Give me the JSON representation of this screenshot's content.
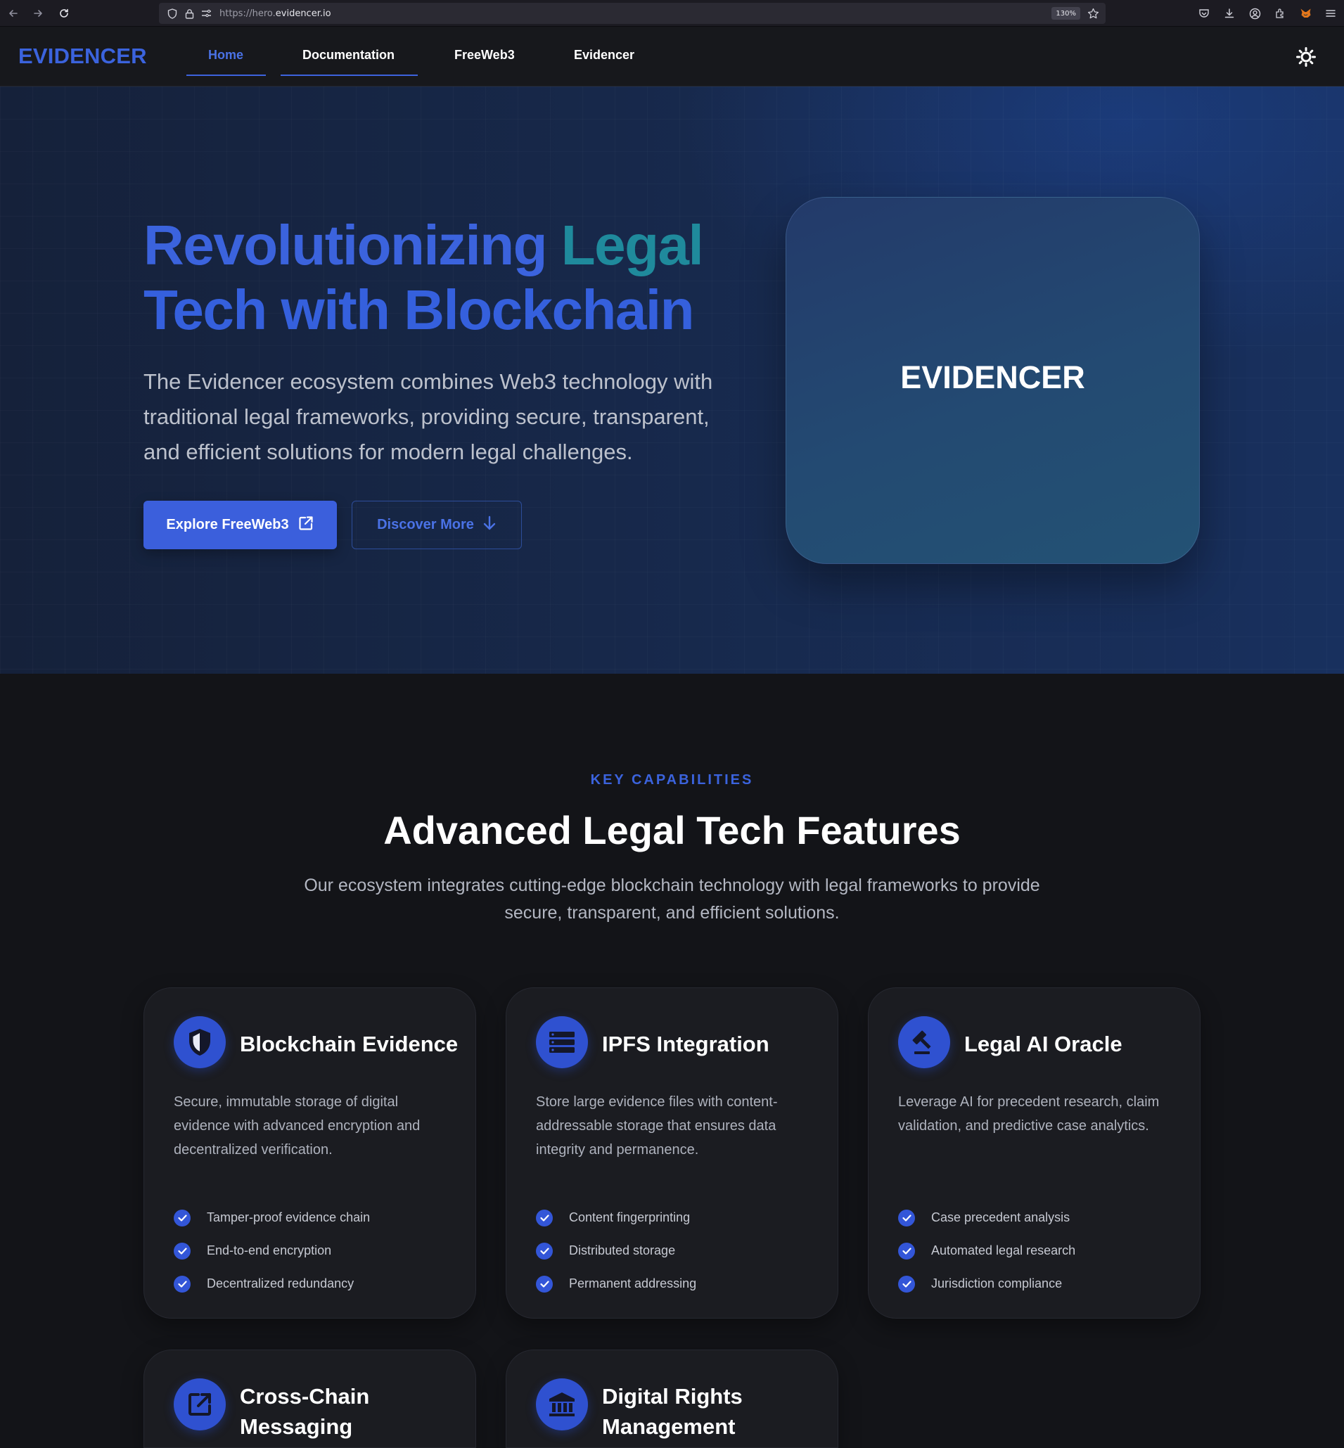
{
  "browser": {
    "url_prefix": "https://hero.",
    "url_host": "evidencer.io",
    "zoom": "130%"
  },
  "header": {
    "logo": "EVIDENCER",
    "nav": [
      {
        "label": "Home",
        "active": true
      },
      {
        "label": "Documentation",
        "active": false
      },
      {
        "label": "FreeWeb3",
        "active": false
      },
      {
        "label": "Evidencer",
        "active": false
      }
    ],
    "theme_icon": "sun-icon"
  },
  "hero": {
    "title_part1": "Revolutionizing ",
    "title_part2": "Legal",
    "title_part3": "Tech with Blockchain",
    "subtitle": "The Evidencer ecosystem combines Web3 technology with traditional legal frameworks, providing secure, transparent, and efficient solutions for modern legal challenges.",
    "primary_button": "Explore FreeWeb3",
    "secondary_button": "Discover More",
    "card_title": "EVIDENCER"
  },
  "features": {
    "eyebrow": "KEY CAPABILITIES",
    "title": "Advanced Legal Tech Features",
    "subtitle": "Our ecosystem integrates cutting-edge blockchain technology with legal frameworks to provide secure, transparent, and efficient solutions.",
    "cards": [
      {
        "icon": "shield-icon",
        "title": "Blockchain Evidence",
        "description": "Secure, immutable storage of digital evidence with advanced encryption and decentralized verification.",
        "items": [
          "Tamper-proof evidence chain",
          "End-to-end encryption",
          "Decentralized redundancy"
        ]
      },
      {
        "icon": "storage-list-icon",
        "title": "IPFS Integration",
        "description": "Store large evidence files with content-addressable storage that ensures data integrity and permanence.",
        "items": [
          "Content fingerprinting",
          "Distributed storage",
          "Permanent addressing"
        ]
      },
      {
        "icon": "gavel-icon",
        "title": "Legal AI Oracle",
        "description": "Leverage AI for precedent research, claim validation, and predictive case analytics.",
        "items": [
          "Case precedent analysis",
          "Automated legal research",
          "Jurisdiction compliance"
        ]
      },
      {
        "icon": "external-link-icon",
        "title": "Cross-Chain Messaging",
        "title_line1": "Cross-Chain",
        "title_line2": "Messaging"
      },
      {
        "icon": "bank-icon",
        "title": "Digital Rights Management",
        "title_line1": "Digital Rights",
        "title_line2": "Management"
      }
    ]
  },
  "colors": {
    "accent": "#3b63dd",
    "teal": "#1f8a9c",
    "background": "#131418",
    "card": "#1b1c21"
  }
}
